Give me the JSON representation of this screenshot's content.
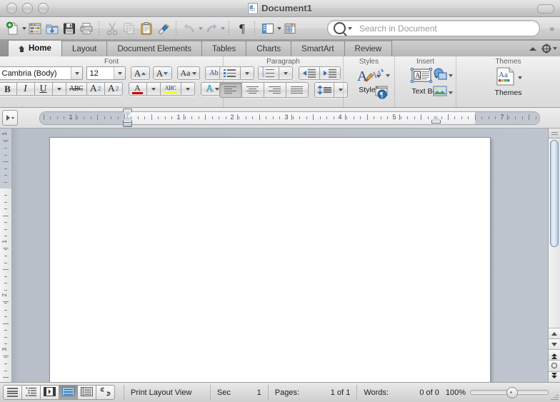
{
  "window": {
    "title": "Document1",
    "title_icon": "word-document-icon",
    "traffic_lights": [
      "close-button",
      "minimize-button",
      "zoom-button"
    ]
  },
  "toolbar": {
    "items": [
      {
        "name": "new-document",
        "icon": "new-doc-icon",
        "has_menu": true
      },
      {
        "name": "open-gallery",
        "icon": "template-gallery-icon",
        "has_menu": false
      },
      {
        "name": "open",
        "icon": "open-folder-icon",
        "has_menu": false
      },
      {
        "name": "save",
        "icon": "floppy-disk-icon",
        "has_menu": false
      },
      {
        "name": "print",
        "icon": "printer-icon",
        "has_menu": false
      },
      {
        "name": "cut",
        "icon": "scissors-icon",
        "has_menu": false
      },
      {
        "name": "copy",
        "icon": "copy-icon",
        "has_menu": false
      },
      {
        "name": "paste",
        "icon": "clipboard-icon",
        "has_menu": false
      },
      {
        "name": "format-painter",
        "icon": "paintbrush-icon",
        "has_menu": false
      },
      {
        "name": "undo",
        "icon": "undo-arrow-icon",
        "has_menu": true
      },
      {
        "name": "redo",
        "icon": "redo-arrow-icon",
        "has_menu": true
      },
      {
        "name": "show-formatting",
        "icon": "pilcrow-icon",
        "has_menu": false
      },
      {
        "name": "sidebar",
        "icon": "sidebar-panel-icon",
        "has_menu": true
      },
      {
        "name": "media-browser",
        "icon": "media-browser-icon",
        "has_menu": false
      }
    ],
    "overflow_label": "»"
  },
  "search": {
    "placeholder": "Search in Document",
    "value": "",
    "icon": "magnifier-icon"
  },
  "tabs": {
    "items": [
      {
        "label": "Home",
        "icon": "home-icon",
        "active": true
      },
      {
        "label": "Layout",
        "icon": "",
        "active": false
      },
      {
        "label": "Document Elements",
        "icon": "",
        "active": false
      },
      {
        "label": "Tables",
        "icon": "",
        "active": false
      },
      {
        "label": "Charts",
        "icon": "",
        "active": false
      },
      {
        "label": "SmartArt",
        "icon": "",
        "active": false
      },
      {
        "label": "Review",
        "icon": "",
        "active": false
      }
    ],
    "collapse_icon": "caret-up-icon",
    "settings_icon": "gear-icon"
  },
  "ribbon": {
    "groups": [
      {
        "title": "Font"
      },
      {
        "title": "Paragraph"
      },
      {
        "title": "Styles"
      },
      {
        "title": "Insert"
      },
      {
        "title": "Themes"
      }
    ],
    "font": {
      "family_value": "Cambria (Body)",
      "size_value": "12",
      "grow_label": "A",
      "shrink_label": "A",
      "case_label": "Aa",
      "clear_label": "Ab",
      "bold_label": "B",
      "italic_label": "I",
      "underline_label": "U",
      "strike_label": "ABC",
      "superscript_label": "A",
      "superscript_sup": "2",
      "subscript_label": "A",
      "subscript_sub": "2",
      "color_label": "A",
      "highlight_label": "ABC",
      "effects_label": "A"
    },
    "paragraph": {
      "bullets_name": "bulleted-list",
      "numbering_name": "numbered-list",
      "decrease_indent_name": "decrease-indent",
      "increase_indent_name": "increase-indent",
      "align_left_name": "align-left",
      "align_center_name": "align-center",
      "align_right_name": "align-right",
      "align_justify_name": "align-justify",
      "line_spacing_name": "line-spacing"
    },
    "styles": {
      "styles_label": "Styles",
      "styles_icon": "styles-brush-icon",
      "quickstyle_icon": "quick-styles-icon",
      "stylepane_icon": "style-pane-icon"
    },
    "insert": {
      "textbox_label": "Text Box",
      "textbox_icon": "text-box-icon",
      "shapes_icon": "shapes-icon",
      "picture_icon": "picture-icon"
    },
    "themes": {
      "themes_label": "Themes",
      "themes_icon": "themes-icon",
      "sample_text": "Aa"
    }
  },
  "ruler": {
    "tab_stop_selector": "tab-stop-selector",
    "labels": [
      "1",
      "1",
      "2",
      "3",
      "4",
      "5",
      "7"
    ],
    "unit": "inches",
    "left_indent_marker": "left-indent-marker",
    "right_indent_marker": "right-indent-marker"
  },
  "vertical_ruler": {
    "labels": [
      "1",
      "1",
      "2",
      "3"
    ]
  },
  "document": {
    "page_content": "",
    "page_count": 1
  },
  "scrollbar": {
    "split_handle": "split-window-handle",
    "up_arrow": "scroll-up-arrow",
    "down_arrow": "scroll-down-arrow",
    "prev_page": "previous-page-button",
    "select_browse_object": "select-browse-object-button",
    "next_page": "next-page-button"
  },
  "status": {
    "view_buttons": [
      {
        "name": "draft-view",
        "icon": "draft-view-icon",
        "active": false
      },
      {
        "name": "outline-view",
        "icon": "outline-view-icon",
        "active": false
      },
      {
        "name": "publishing-layout-view",
        "icon": "publishing-view-icon",
        "active": false
      },
      {
        "name": "print-layout-view",
        "icon": "print-layout-icon",
        "active": true
      },
      {
        "name": "notebook-layout-view",
        "icon": "notebook-view-icon",
        "active": false
      },
      {
        "name": "full-screen-view",
        "icon": "full-screen-icon",
        "active": false
      }
    ],
    "view_name": "Print Layout View",
    "sec_label": "Sec",
    "sec_value": "1",
    "pages_label": "Pages:",
    "pages_value": "1 of 1",
    "words_label": "Words:",
    "words_value": "0 of 0",
    "zoom_value": "100%",
    "resize_grip": "resize-grip"
  },
  "colors": {
    "accent_blue": "#2f6fb5",
    "page_white": "#ffffff",
    "canvas_gray": "#bfc5ce",
    "font_color_underline": "#cc0000",
    "highlight_yellow": "#ffff00"
  }
}
